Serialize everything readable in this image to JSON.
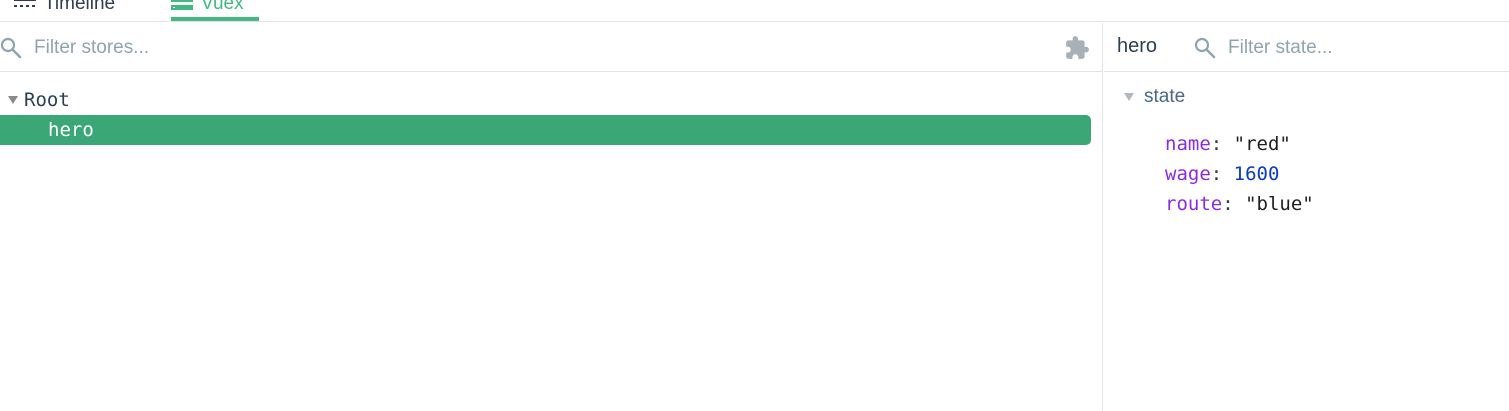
{
  "tabs": [
    {
      "label": "Timeline",
      "icon": "timeline-icon",
      "active": false
    },
    {
      "label": "Vuex",
      "icon": "vuex-icon",
      "active": true
    }
  ],
  "stores": {
    "filter_placeholder": "Filter stores...",
    "plugin_icon": "puzzle-icon",
    "tree": {
      "root_label": "Root",
      "children": [
        {
          "label": "hero",
          "selected": true
        }
      ]
    }
  },
  "inspector": {
    "module_name": "hero",
    "filter_placeholder": "Filter state...",
    "section_label": "state",
    "props": [
      {
        "key": "name",
        "value": "\"red\"",
        "type": "string"
      },
      {
        "key": "wage",
        "value": "1600",
        "type": "number"
      },
      {
        "key": "route",
        "value": "\"blue\"",
        "type": "string"
      }
    ]
  },
  "colors": {
    "accent": "#42b983",
    "selected_row": "#3ba776",
    "key": "#8a2be2",
    "number": "#0b3bbf"
  }
}
